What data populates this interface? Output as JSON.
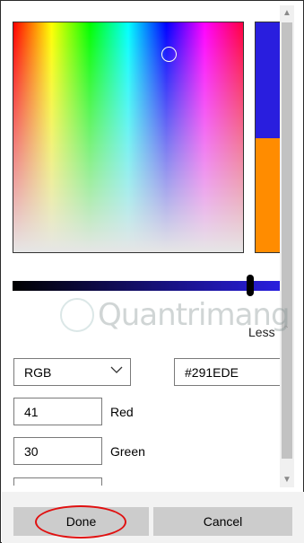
{
  "color": {
    "mode": "RGB",
    "hex": "#291EDE",
    "red": "41",
    "green": "30",
    "new_color": "#291ede",
    "old_color": "#ff8c00",
    "value_level": 0.9
  },
  "labels": {
    "red": "Red",
    "green": "Green",
    "less": "Less"
  },
  "buttons": {
    "done": "Done",
    "cancel": "Cancel"
  },
  "watermark": {
    "text": "Quantrimang"
  },
  "icons": {
    "dropdown": "chevron-down-icon",
    "less": "chevron-up-icon",
    "scroll_up": "scroll-up-arrow",
    "scroll_down": "scroll-down-arrow"
  }
}
